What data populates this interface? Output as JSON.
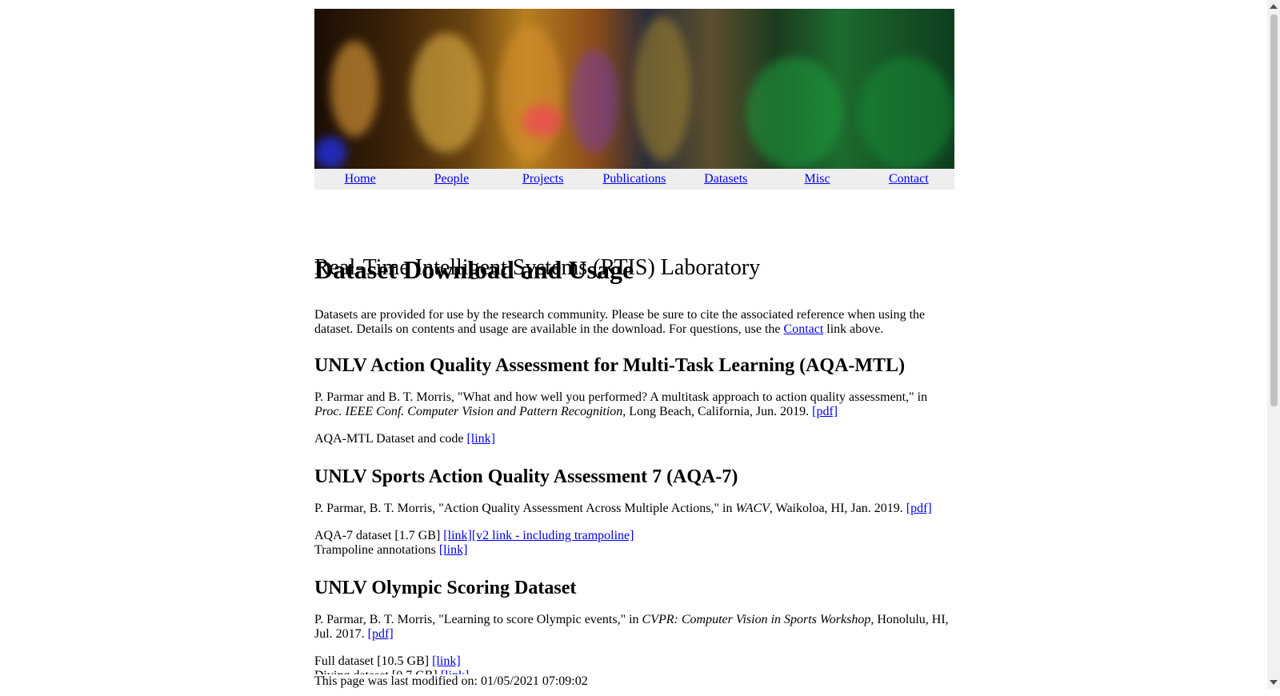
{
  "site": {
    "title": "Real-Time Intelligent Systems (RTIS) Laboratory"
  },
  "nav": [
    {
      "label": "Home"
    },
    {
      "label": "People"
    },
    {
      "label": "Projects"
    },
    {
      "label": "Publications"
    },
    {
      "label": "Datasets"
    },
    {
      "label": "Misc"
    },
    {
      "label": "Contact"
    }
  ],
  "page": {
    "heading": "Dataset Download and Usage",
    "intro_before": "Datasets are provided for use by the research community. Please be sure to cite the associated reference when using the dataset. Details on contents and usage are available in the download. For questions, use the ",
    "intro_link": "Contact",
    "intro_after": " link above."
  },
  "sections": [
    {
      "title": "UNLV Action Quality Assessment for Multi-Task Learning (AQA-MTL)",
      "citation_a": "P. Parmar and B. T. Morris, \"What and how well you performed? A multitask approach to action quality assessment,\" in ",
      "citation_venue": "Proc. IEEE Conf. Computer Vision and Pattern Recognition",
      "citation_b": ", Long Beach, California, Jun. 2019. ",
      "pdf": "[pdf]",
      "line1_text": "AQA-MTL Dataset and code ",
      "line1_link": "[link]"
    },
    {
      "title": "UNLV Sports Action Quality Assessment 7 (AQA-7)",
      "citation_a": "P. Parmar, B. T. Morris, \"Action Quality Assessment Across Multiple Actions,\" in ",
      "citation_venue": "WACV",
      "citation_b": ", Waikoloa, HI, Jan. 2019. ",
      "pdf": "[pdf]",
      "line1_text": "AQA-7 dataset [1.7 GB] ",
      "line1_link": "[link]",
      "line1_link2": "[v2 link - including trampoline]",
      "line2_text": "Trampoline annotations ",
      "line2_link": "[link]"
    },
    {
      "title": "UNLV Olympic Scoring Dataset",
      "citation_a": "P. Parmar, B. T. Morris, \"Learning to score Olympic events,\" in ",
      "citation_venue": "CVPR: Computer Vision in Sports Workshop",
      "citation_b": ", Honolulu, HI, Jul. 2017. ",
      "pdf": "[pdf]",
      "line1_text": "Full dataset [10.5 GB] ",
      "line1_link": "[link]",
      "line2_text": "Diving dataset [0.7 GB] ",
      "line2_link": "[link]"
    }
  ],
  "footer": {
    "text": "This page was last modified on: 01/05/2021 07:09:02"
  }
}
